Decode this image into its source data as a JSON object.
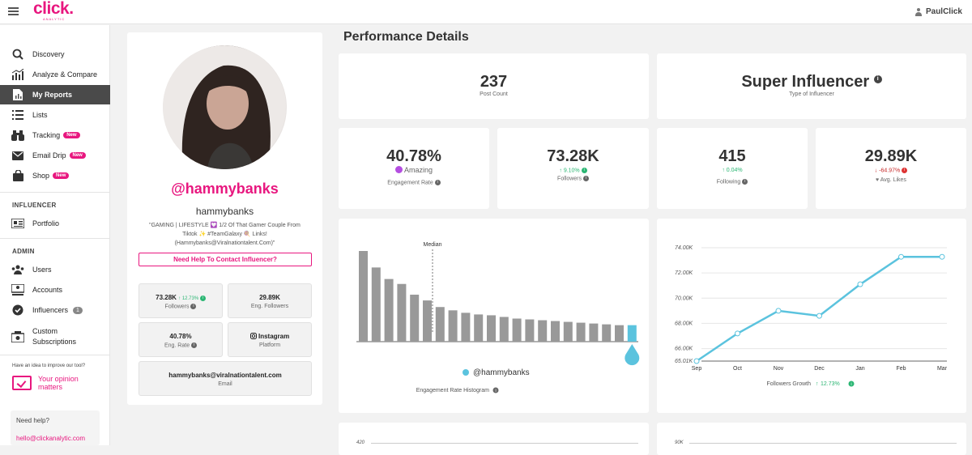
{
  "header": {
    "logo": "click.",
    "logo_sub": "ANALYTIC",
    "user": "PaulClick"
  },
  "sidebar": {
    "items": [
      {
        "label": "Discovery",
        "icon": "search-icon"
      },
      {
        "label": "Analyze & Compare",
        "icon": "analyze-chart-icon"
      },
      {
        "label": "My Reports",
        "icon": "report-icon",
        "active": true
      },
      {
        "label": "Lists",
        "icon": "list-icon"
      },
      {
        "label": "Tracking",
        "icon": "binoculars-icon",
        "badge": "New"
      },
      {
        "label": "Email Drip",
        "icon": "envelope-icon",
        "badge": "New"
      },
      {
        "label": "Shop",
        "icon": "shopping-bag-icon",
        "badge": "New"
      }
    ],
    "influencer_section": "INFLUENCER",
    "influencer_items": [
      {
        "label": "Portfolio",
        "icon": "portfolio-icon"
      }
    ],
    "admin_section": "ADMIN",
    "admin_items": [
      {
        "label": "Users",
        "icon": "users-icon"
      },
      {
        "label": "Accounts",
        "icon": "accounts-icon"
      },
      {
        "label": "Influencers",
        "icon": "check-badge-icon",
        "count": "1"
      },
      {
        "label": "Custom",
        "label2": "Subscriptions",
        "icon": "subscriptions-icon"
      }
    ],
    "improve_text": "Have an idea to improve our tool?",
    "opinion": {
      "line1": "Your opinion",
      "line2": "matters"
    },
    "need_help": "Need help?",
    "help_email": "hello@clickanalytic.com"
  },
  "profile": {
    "handle": "@hammybanks",
    "name": "hammybanks",
    "bio": "\"GAMING | LIFESTYLE 💟 1/2 Of That Gamer Couple From Tiktok ✨ #TeamGalaxy 🍭 Links! (Hammybanks@Viralnationtalent.Com)\"",
    "contact_button": "Need Help To Contact Influencer?",
    "followers": {
      "value": "73.28K",
      "change": "12.73%",
      "label": "Followers"
    },
    "eng_followers": {
      "value": "29.89K",
      "label": "Eng. Followers"
    },
    "eng_rate": {
      "value": "40.78%",
      "label": "Eng. Rate"
    },
    "platform": {
      "value": "Instagram",
      "label": "Platform"
    },
    "email": {
      "value": "hammybanks@viralnationtalent.com",
      "label": "Email"
    }
  },
  "performance": {
    "title": "Performance Details",
    "post_count": {
      "value": "237",
      "label": "Post Count"
    },
    "influencer_type": {
      "value": "Super Influencer",
      "label": "Type of Influencer"
    },
    "engagement_rate": {
      "value": "40.78%",
      "tier": "Amazing",
      "label": "Engagement Rate"
    },
    "followers": {
      "value": "73.28K",
      "change": "9.10%",
      "label": "Followers"
    },
    "following": {
      "value": "415",
      "change": "0.04%",
      "label": "Following"
    },
    "avg_likes": {
      "value": "29.89K",
      "change": "-64.97%",
      "label": "Avg. Likes"
    }
  },
  "colors": {
    "accent": "#e8177f",
    "chart_line": "#5bc3de",
    "bar_gray": "#999999",
    "green": "#2bb673",
    "red": "#c62828",
    "purple": "#b44ee0"
  },
  "chart_data": [
    {
      "type": "bar",
      "title": "Engagement Rate Histogram",
      "median_label": "Median",
      "highlight_label": "@hammybanks",
      "values": [
        110,
        90,
        76,
        70,
        57,
        50,
        42,
        38,
        35,
        33,
        32,
        30,
        28,
        27,
        26,
        25,
        24,
        23,
        22,
        21,
        20
      ],
      "highlight_value": 20
    },
    {
      "type": "line",
      "title": "Followers Growth",
      "change": "12.73%",
      "x": [
        "Sep",
        "Oct",
        "Nov",
        "Dec",
        "Jan",
        "Feb",
        "Mar"
      ],
      "y": [
        65.01,
        67.2,
        69.0,
        68.6,
        71.1,
        73.28,
        73.28
      ],
      "y_ticks": [
        "74.00K",
        "72.00K",
        "70.00K",
        "68.00K",
        "66.00K",
        "65.01K"
      ],
      "ylim": [
        65.01,
        74.0
      ]
    }
  ],
  "bottom": {
    "left_tick": "420",
    "right_tick": "90K"
  }
}
